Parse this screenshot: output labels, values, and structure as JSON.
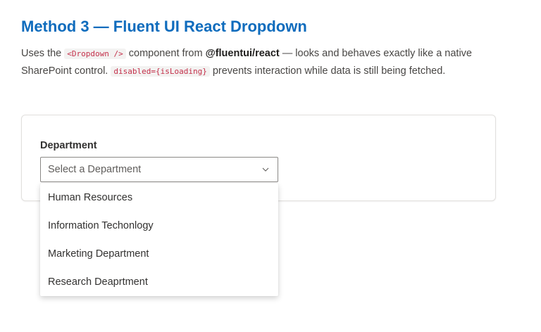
{
  "section": {
    "title": "Method 3 — Fluent UI React Dropdown",
    "description": {
      "part1": "Uses the ",
      "code_component": "<Dropdown />",
      "part2": " component from ",
      "package": "@fluentui/react",
      "part3": " — looks and behaves exactly like a native SharePoint control. ",
      "code_disabled": "disabled={isLoading}",
      "part4": " prevents interaction while data is still being fetched."
    }
  },
  "form": {
    "field_label": "Department",
    "dropdown": {
      "placeholder": "Select a Department",
      "icon": "chevron-down-icon",
      "expanded": true,
      "options": [
        "Human Resources",
        "Information Techonlogy",
        "Marketing Department",
        "Research Deaprtment"
      ]
    }
  },
  "colors": {
    "heading": "#0f6cbd",
    "code_text": "#c4314b",
    "code_background": "#f3f2f1",
    "border": "#8a8886"
  }
}
